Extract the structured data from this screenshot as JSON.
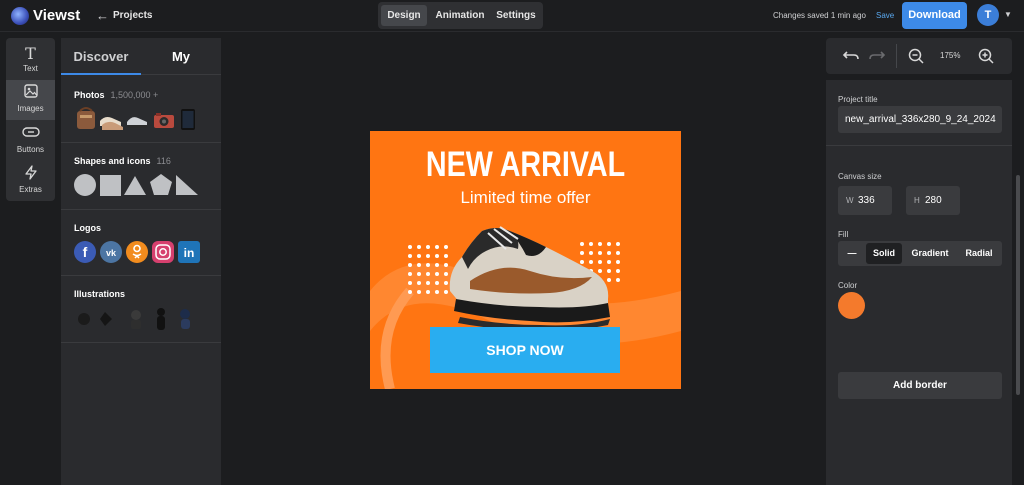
{
  "app": {
    "name": "Viewst"
  },
  "topbar": {
    "back_label": "Projects",
    "tabs": [
      "Design",
      "Animation",
      "Settings"
    ],
    "saved_status": "Changes saved 1 min ago",
    "save_label": "Save",
    "download_label": "Download",
    "avatar_initial": "T"
  },
  "rail": [
    {
      "label": "Text",
      "icon": "T"
    },
    {
      "label": "Images",
      "icon": "image"
    },
    {
      "label": "Buttons",
      "icon": "button"
    },
    {
      "label": "Extras",
      "icon": "bolt"
    }
  ],
  "assets": {
    "tabs": [
      "Discover",
      "My"
    ],
    "sections": [
      {
        "title": "Photos",
        "count": "1,500,000 +"
      },
      {
        "title": "Shapes and icons",
        "count": "116"
      },
      {
        "title": "Logos",
        "count": ""
      },
      {
        "title": "Illustrations",
        "count": ""
      }
    ],
    "logos": [
      "f",
      "vk",
      "ok",
      "ig",
      "in"
    ]
  },
  "banner": {
    "title": "NEW ARRIVAL",
    "subtitle": "Limited time offer",
    "cta": "SHOP NOW",
    "background_color": "#ff7512",
    "cta_color": "#29adf0"
  },
  "toolbar": {
    "zoom": "175%"
  },
  "properties": {
    "project_title_label": "Project title",
    "project_title_value": "new_arrival_336x280_9_24_2024",
    "canvas_size_label": "Canvas size",
    "width_prefix": "W",
    "width_value": "336",
    "height_prefix": "H",
    "height_value": "280",
    "fill_label": "Fill",
    "fill_options": [
      "—",
      "Solid",
      "Gradient",
      "Radial"
    ],
    "fill_selected": "Solid",
    "color_label": "Color",
    "color_value": "#ff7512",
    "add_border_label": "Add border"
  }
}
